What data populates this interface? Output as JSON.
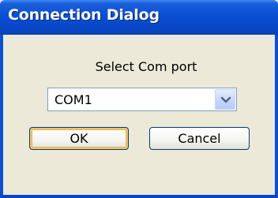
{
  "window": {
    "title": "Connection Dialog"
  },
  "dialog": {
    "prompt_label": "Select Com port",
    "port_select": {
      "selected_value": "COM1"
    },
    "buttons": {
      "ok_label": "OK",
      "cancel_label": "Cancel"
    }
  }
}
